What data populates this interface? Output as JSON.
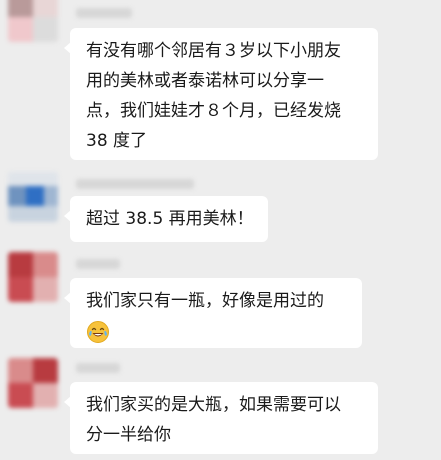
{
  "colors": {
    "background": "#ededed",
    "bubble": "#ffffff",
    "text": "#1a1a1a"
  },
  "messages": [
    {
      "sender_avatar": "blurred-avatar-pink",
      "lines": [
        "有没有哪个邻居有３岁以下小朋友",
        "用的美林或者泰诺林可以分享一",
        "点，我们娃娃才８个月，已经发烧",
        "38 度了"
      ]
    },
    {
      "sender_avatar": "blurred-avatar-blue",
      "lines": [
        "超过 38.5 再用美林！"
      ]
    },
    {
      "sender_avatar": "blurred-avatar-red",
      "lines": [
        "我们家只有一瓶，好像是用过的"
      ],
      "emoji": "tears-of-joy-emoji"
    },
    {
      "sender_avatar": "blurred-avatar-red",
      "lines": [
        "我们家买的是大瓶，如果需要可以",
        "分一半给你"
      ]
    }
  ]
}
